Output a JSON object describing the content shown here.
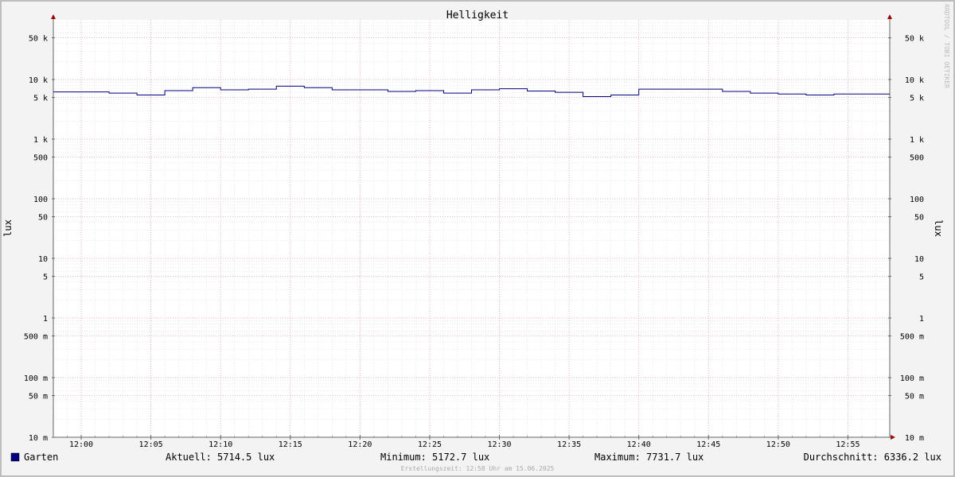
{
  "chart_data": {
    "type": "line",
    "title": "Helligkeit",
    "ylabel_left": "lux",
    "ylabel_right": "lux",
    "watermark": "RRDTOOL / TOBI OETIKER",
    "y_scale": "log",
    "ylim": [
      0.01,
      100000
    ],
    "grid": true,
    "x_start": "11:58",
    "x_end": "12:58",
    "x_ticks": [
      "12:00",
      "12:05",
      "12:10",
      "12:15",
      "12:20",
      "12:25",
      "12:30",
      "12:35",
      "12:40",
      "12:45",
      "12:50",
      "12:55"
    ],
    "y_ticks": [
      {
        "value": 50000,
        "label": "50 k"
      },
      {
        "value": 10000,
        "label": "10 k"
      },
      {
        "value": 5000,
        "label": "5 k"
      },
      {
        "value": 1000,
        "label": "1 k"
      },
      {
        "value": 500,
        "label": "500"
      },
      {
        "value": 100,
        "label": "100"
      },
      {
        "value": 50,
        "label": "50"
      },
      {
        "value": 10,
        "label": "10"
      },
      {
        "value": 5,
        "label": "5"
      },
      {
        "value": 1,
        "label": "1"
      },
      {
        "value": 0.5,
        "label": "500 m"
      },
      {
        "value": 0.1,
        "label": "100 m"
      },
      {
        "value": 0.05,
        "label": "50 m"
      },
      {
        "value": 0.01,
        "label": "10 m"
      }
    ],
    "series": [
      {
        "name": "Garten",
        "color": "#000080",
        "step": true,
        "points": [
          {
            "x": "11:58",
            "y": 6200
          },
          {
            "x": "12:02",
            "y": 5900
          },
          {
            "x": "12:04",
            "y": 5500
          },
          {
            "x": "12:06",
            "y": 6500
          },
          {
            "x": "12:08",
            "y": 7300
          },
          {
            "x": "12:10",
            "y": 6700
          },
          {
            "x": "12:12",
            "y": 6900
          },
          {
            "x": "12:14",
            "y": 7731.7
          },
          {
            "x": "12:16",
            "y": 7300
          },
          {
            "x": "12:18",
            "y": 6700
          },
          {
            "x": "12:22",
            "y": 6300
          },
          {
            "x": "12:24",
            "y": 6500
          },
          {
            "x": "12:26",
            "y": 5900
          },
          {
            "x": "12:28",
            "y": 6700
          },
          {
            "x": "12:30",
            "y": 7000
          },
          {
            "x": "12:32",
            "y": 6400
          },
          {
            "x": "12:34",
            "y": 6100
          },
          {
            "x": "12:36",
            "y": 5172.7
          },
          {
            "x": "12:38",
            "y": 5500
          },
          {
            "x": "12:40",
            "y": 6900
          },
          {
            "x": "12:46",
            "y": 6300
          },
          {
            "x": "12:48",
            "y": 5900
          },
          {
            "x": "12:50",
            "y": 5700
          },
          {
            "x": "12:52",
            "y": 5500
          },
          {
            "x": "12:54",
            "y": 5714.5
          },
          {
            "x": "12:58",
            "y": 5714.5
          }
        ]
      }
    ]
  },
  "legend": {
    "series_name": "Garten",
    "swatch_color": "#000080",
    "current": "Aktuell: 5714.5 lux",
    "minimum": "Minimum: 5172.7 lux",
    "maximum": "Maximum: 7731.7 lux",
    "average": "Durchschnitt: 6336.2 lux"
  },
  "footer": "Erstellungszeit: 12:58 Uhr am 15.06.2025"
}
